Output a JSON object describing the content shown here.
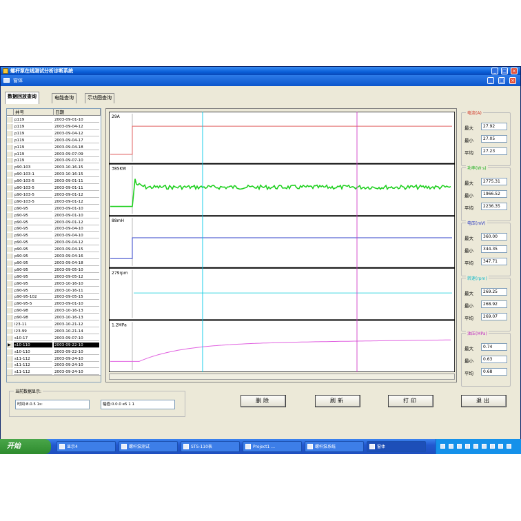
{
  "window": {
    "title": "螺杆泵在线测试分析诊断系统",
    "controls": [
      "_",
      "□",
      "×"
    ],
    "mdi_controls": [
      "_",
      "□",
      "×"
    ],
    "menu_label": "窗体"
  },
  "tabs": [
    {
      "label": "数据回放查询",
      "active": true
    },
    {
      "label": "电能查询",
      "active": false
    },
    {
      "label": "示功图查询",
      "active": false
    }
  ],
  "list": {
    "columns": [
      "井号",
      "日期"
    ],
    "rows": [
      {
        "well": "p119",
        "date": "2003-09-01-10"
      },
      {
        "well": "p119",
        "date": "2003-09-04-12"
      },
      {
        "well": "p119",
        "date": "2003-09-04-12"
      },
      {
        "well": "p119",
        "date": "2003-09-04-17"
      },
      {
        "well": "p119",
        "date": "2003-09-04-18"
      },
      {
        "well": "p119",
        "date": "2003-09-07-09"
      },
      {
        "well": "p119",
        "date": "2003-09-07-10"
      },
      {
        "well": "p90-103",
        "date": "2003-10-16-15"
      },
      {
        "well": "p90-103-1",
        "date": "2003-10-16-15"
      },
      {
        "well": "p90-103-5",
        "date": "2003-09-01-11"
      },
      {
        "well": "p90-103-5",
        "date": "2003-09-01-11"
      },
      {
        "well": "p90-103-5",
        "date": "2003-09-01-12"
      },
      {
        "well": "p90-103-5",
        "date": "2003-09-01-12"
      },
      {
        "well": "p90-95",
        "date": "2003-09-01-10"
      },
      {
        "well": "p90-95",
        "date": "2003-09-01-10"
      },
      {
        "well": "p90-95",
        "date": "2003-09-01-12"
      },
      {
        "well": "p90-95",
        "date": "2003-09-04-10"
      },
      {
        "well": "p90-95",
        "date": "2003-09-04-10"
      },
      {
        "well": "p90-95",
        "date": "2003-09-04-12"
      },
      {
        "well": "p90-95",
        "date": "2003-09-04-15"
      },
      {
        "well": "p90-95",
        "date": "2003-09-04-16"
      },
      {
        "well": "p90-95",
        "date": "2003-09-04-18"
      },
      {
        "well": "p90-95",
        "date": "2003-09-05-10"
      },
      {
        "well": "p90-95",
        "date": "2003-09-05-12"
      },
      {
        "well": "p90-95",
        "date": "2003-10-16-10"
      },
      {
        "well": "p90-95",
        "date": "2003-10-16-11"
      },
      {
        "well": "p90-95-102",
        "date": "2003-09-05-15"
      },
      {
        "well": "p90-95-5",
        "date": "2003-09-01-10"
      },
      {
        "well": "p90-98",
        "date": "2003-10-16-13"
      },
      {
        "well": "p90-98",
        "date": "2003-10-16-13"
      },
      {
        "well": "l23-11",
        "date": "2003-10-21-12"
      },
      {
        "well": "l23-99",
        "date": "2003-10-21-14"
      },
      {
        "well": "s10-17",
        "date": "2003-09-07-10"
      },
      {
        "well": "s10-110",
        "date": "2003-09-22-10"
      },
      {
        "well": "s10-110",
        "date": "2003-09-22-10"
      },
      {
        "well": "s11-112",
        "date": "2003-09-24-10"
      },
      {
        "well": "s11-112",
        "date": "2003-09-24-10"
      },
      {
        "well": "s11-112",
        "date": "2003-09-24-10"
      }
    ],
    "selected_index": 33
  },
  "chart_data": {
    "type": "line",
    "cursor_colors": [
      "#00c8e6",
      "#d040c8"
    ],
    "panels": [
      {
        "label": "29A",
        "color": "#e06060",
        "shape": "step",
        "level": 0.72
      },
      {
        "label": "38SKW",
        "color": "#20d020",
        "shape": "noisy",
        "level": 0.55
      },
      {
        "label": "88mH",
        "color": "#3040c8",
        "shape": "step",
        "level": 0.58
      },
      {
        "label": "279rpm",
        "color": "#40d8e0",
        "shape": "flat",
        "level": 0.52
      },
      {
        "label": "1.2MPa",
        "color": "#e060e0",
        "shape": "rise",
        "level": 0.62
      }
    ]
  },
  "stats": [
    {
      "title": "电流(A)",
      "color": "#d03020",
      "max_label": "最大",
      "min_label": "最小",
      "avg_label": "平均",
      "max": "27.92",
      "min": "27.05",
      "avg": "27.23"
    },
    {
      "title": "功率(W·s)",
      "color": "#20b020",
      "max_label": "最大",
      "min_label": "最小",
      "avg_label": "平均",
      "max": "2775.31",
      "min": "1966.52",
      "avg": "2236.35"
    },
    {
      "title": "电压(mV)",
      "color": "#2030c0",
      "max_label": "最大",
      "min_label": "最小",
      "avg_label": "平均",
      "max": "360.00",
      "min": "344.35",
      "avg": "347.71"
    },
    {
      "title": "转速(rpm)",
      "color": "#10b8c8",
      "max_label": "最大",
      "min_label": "最小",
      "avg_label": "平均",
      "max": "269.25",
      "min": "268.92",
      "avg": "269.07"
    },
    {
      "title": "油压(MPa)",
      "color": "#c030c0",
      "max_label": "最大",
      "min_label": "最小",
      "avg_label": "平均",
      "max": "0.74",
      "min": "0.63",
      "avg": "0.68"
    }
  ],
  "info": {
    "group_title": "当前数据显示:",
    "box1": "时间:8.0.5 1s:",
    "box2": "幅值:0.0.0 e5 1 1"
  },
  "buttons": {
    "delete": "删除",
    "refresh": "刷新",
    "print": "打印",
    "exit": "退出"
  },
  "taskbar": {
    "start": "开始",
    "tasks": [
      "显示4",
      "螺杆泵测试",
      "STS-110表",
      "Project1 ...",
      "螺杆泵系统",
      "窗体"
    ]
  }
}
